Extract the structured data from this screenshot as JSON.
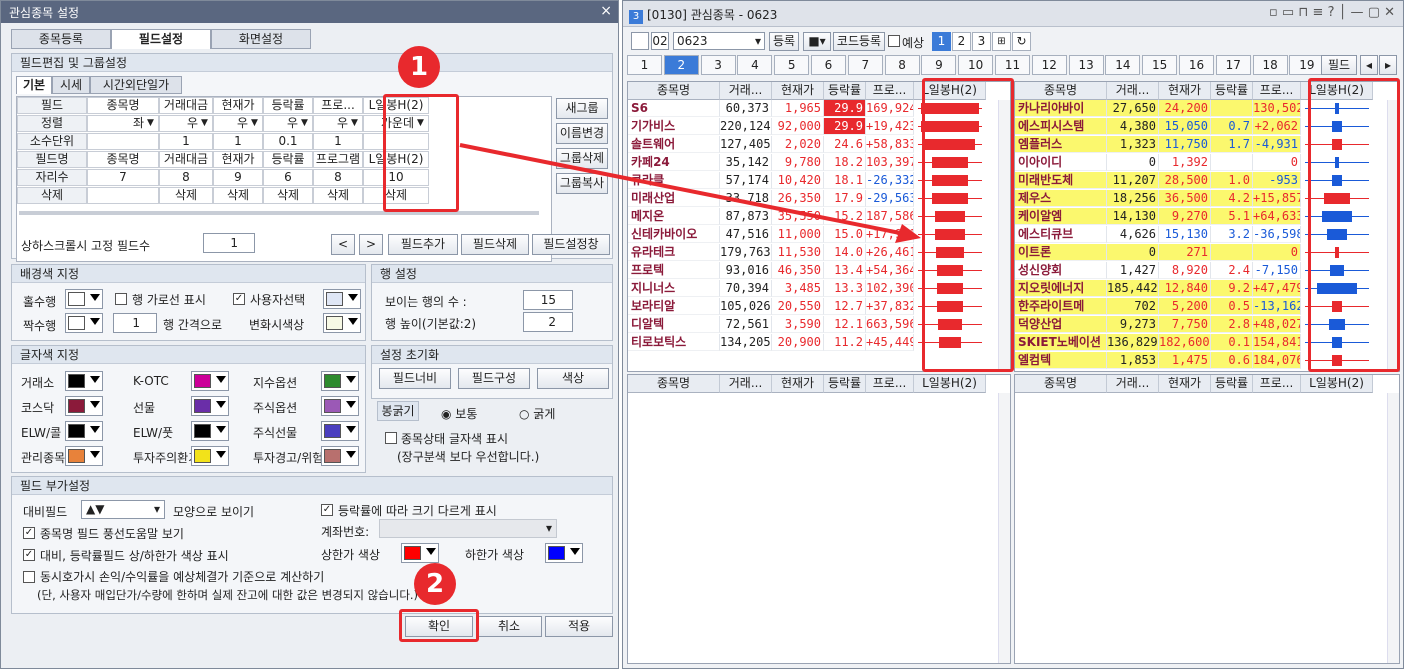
{
  "dialog": {
    "title": "관심종목 설정",
    "close": "×",
    "tabs": [
      "종목등록",
      "필드설정",
      "화면설정"
    ],
    "field_edit": {
      "header": "필드편집 및 그룹설정",
      "subtabs": [
        "기본",
        "시세",
        "시간외단일가"
      ],
      "row_labels": [
        "필드",
        "정렬",
        "소수단위",
        "필드명",
        "자리수",
        "삭제"
      ],
      "columns": [
        {
          "field": "종목명",
          "align": "좌",
          "dec": "",
          "name": "종목명",
          "digits": "7",
          "del": ""
        },
        {
          "field": "거래대금",
          "align": "우",
          "dec": "1",
          "name": "거래대금",
          "digits": "8",
          "del": "삭제"
        },
        {
          "field": "현재가",
          "align": "우",
          "dec": "1",
          "name": "현재가",
          "digits": "9",
          "del": "삭제"
        },
        {
          "field": "등락률",
          "align": "우",
          "dec": "0.1",
          "name": "등락률",
          "digits": "6",
          "del": "삭제"
        },
        {
          "field": "프로...",
          "align": "우",
          "dec": "1",
          "name": "프로그램",
          "digits": "8",
          "del": "삭제"
        },
        {
          "field": "L일봉H(2)",
          "align": "가운데",
          "dec": "",
          "name": "L일봉H(2)",
          "digits": "10",
          "del": "삭제"
        }
      ],
      "side_buttons": [
        "새그룹",
        "이름변경",
        "그룹삭제",
        "그룹복사"
      ],
      "fixed_label": "상하스크롤시 고정 필드수",
      "fixed_value": "1",
      "bottom_buttons": [
        "<",
        ">",
        "필드추가",
        "필드삭제",
        "필드설정창"
      ]
    },
    "bg": {
      "header": "배경색 지정",
      "odd": "홀수행",
      "even": "짝수행",
      "hline": "행 가로선 표시",
      "gap_value": "1",
      "gap": "행 간격으로",
      "user_sel": "사용자선택",
      "change": "변화시색상"
    },
    "row": {
      "header": "행 설정",
      "visible": "보이는 행의 수 :",
      "visible_value": "15",
      "height": "행 높이(기본값:2)",
      "height_value": "2"
    },
    "font": {
      "header": "글자색 지정",
      "items": [
        {
          "label": "거래소",
          "color": "#000000"
        },
        {
          "label": "K-OTC",
          "color": "#cc0099"
        },
        {
          "label": "지수옵션",
          "color": "#2e8b2e"
        },
        {
          "label": "코스닥",
          "color": "#8b1a3a"
        },
        {
          "label": "선물",
          "color": "#6a2ea8"
        },
        {
          "label": "주식옵션",
          "color": "#9b59b6"
        },
        {
          "label": "ELW/콜",
          "color": "#000000"
        },
        {
          "label": "ELW/풋",
          "color": "#000000"
        },
        {
          "label": "주식선물",
          "color": "#4b3fbf"
        },
        {
          "label": "관리종목",
          "color": "#e8823a"
        },
        {
          "label": "투자주의환기",
          "color": "#f2e21a"
        },
        {
          "label": "투자경고/위험",
          "color": "#b8706e"
        }
      ]
    },
    "reset": {
      "header": "설정 초기화",
      "buttons": [
        "필드너비",
        "필드구성",
        "색상"
      ]
    },
    "candle": {
      "label": "봉굵기",
      "normal": "보통",
      "thick": "굵게"
    },
    "status": {
      "label": "종목상태 글자색 표시",
      "note": "(장구분색 보다 우선합니다.)"
    },
    "extra": {
      "header": "필드 부가설정",
      "compare": "대비필드",
      "compare_value": "▲▼",
      "shape": "모양으로 보이기",
      "size": "등락률에 따라 크기 다르게 표시",
      "balloon": "종목명 필드 풍선도움말 보기",
      "account": "계좌번호:",
      "limit": "대비, 등락률필드 상/하한가 색상 표시",
      "upper": "상한가 색상",
      "lower": "하한가 색상",
      "upper_color": "#ff0000",
      "lower_color": "#0000ff",
      "simul": "동시호가시 손익/수익률을 예상체결가 기준으로 계산하기",
      "simul_note": "(단, 사용자 매입단가/수량에 한하며 실제 잔고에 대한 값은 변경되지 않습니다.)"
    },
    "footer": {
      "ok": "확인",
      "cancel": "취소",
      "apply": "적용"
    },
    "markers": [
      "1",
      "2"
    ]
  },
  "window": {
    "title_num": "3",
    "title": "[0130] 관심종목 - 0623",
    "toolbar": {
      "group_no": "02",
      "group_name": "0623",
      "register": "등록",
      "code_register": "코드등록",
      "reserve": "예상",
      "pages": [
        "1",
        "2",
        "3"
      ]
    },
    "pgtabs": [
      "1",
      "2",
      "3",
      "4",
      "5",
      "6",
      "7",
      "8",
      "9",
      "10",
      "11",
      "12",
      "13",
      "14",
      "15",
      "16",
      "17",
      "18",
      "19"
    ],
    "pg_field": "필드",
    "headers": [
      "종목명",
      "거래...",
      "현재가",
      "등락률",
      "프로...",
      "L일봉H(2)"
    ],
    "left_rows": [
      [
        "S6",
        "60,373",
        "1,965",
        "29.9",
        "169,924"
      ],
      [
        "기가비스",
        "220,124",
        "92,000",
        "29.9",
        "+19,423"
      ],
      [
        "솔트웨어",
        "127,405",
        "2,020",
        "24.6",
        "+58,833"
      ],
      [
        "카페24",
        "35,142",
        "9,780",
        "18.2",
        "103,397"
      ],
      [
        "큐라클",
        "57,174",
        "10,420",
        "18.1",
        "-26,332"
      ],
      [
        "미래산업",
        "33,718",
        "26,350",
        "17.9",
        "-29,563"
      ],
      [
        "메지온",
        "87,873",
        "35,550",
        "15.2",
        "187,586"
      ],
      [
        "신테카바이오",
        "47,516",
        "11,000",
        "15.0",
        "+17,951"
      ],
      [
        "유라테크",
        "179,763",
        "11,530",
        "14.0",
        "+26,461"
      ],
      [
        "프로텍",
        "93,016",
        "46,350",
        "13.4",
        "+54,364"
      ],
      [
        "지니너스",
        "70,394",
        "3,485",
        "13.3",
        "102,390"
      ],
      [
        "보라티알",
        "105,026",
        "20,550",
        "12.7",
        "+37,832"
      ],
      [
        "디알텍",
        "72,561",
        "3,590",
        "12.1",
        "663,596"
      ],
      [
        "티로보틱스",
        "134,205",
        "20,900",
        "11.2",
        "+45,449"
      ]
    ],
    "right_rows": [
      [
        "카나리아바이",
        "27,650",
        "24,200",
        "",
        "130,502"
      ],
      [
        "에스피시스템",
        "4,380",
        "15,050",
        "0.7",
        "+2,062"
      ],
      [
        "엠플러스",
        "1,323",
        "11,750",
        "1.7",
        "-4,931"
      ],
      [
        "이아이디",
        "0",
        "1,392",
        "",
        "0"
      ],
      [
        "미래반도체",
        "11,207",
        "28,500",
        "1.0",
        "-953"
      ],
      [
        "제우스",
        "18,256",
        "36,500",
        "4.2",
        "+15,857"
      ],
      [
        "케이알엠",
        "14,130",
        "9,270",
        "5.1",
        "+64,633"
      ],
      [
        "에스티큐브",
        "4,626",
        "15,130",
        "3.2",
        "-36,598"
      ],
      [
        "이트론",
        "0",
        "271",
        "",
        "0"
      ],
      [
        "성신양회",
        "1,427",
        "8,920",
        "2.4",
        "-7,150"
      ],
      [
        "지오릿에너지",
        "185,442",
        "12,840",
        "9.2",
        "+47,479"
      ],
      [
        "한주라이트메",
        "702",
        "5,200",
        "0.5",
        "-13,162"
      ],
      [
        "덕양산업",
        "9,273",
        "7,750",
        "2.8",
        "+48,027"
      ],
      [
        "SKIET노베이션",
        "136,829",
        "182,600",
        "0.1",
        "154,841"
      ],
      [
        "엘컴텍",
        "1,853",
        "1,475",
        "0.6",
        "184,076"
      ]
    ]
  }
}
